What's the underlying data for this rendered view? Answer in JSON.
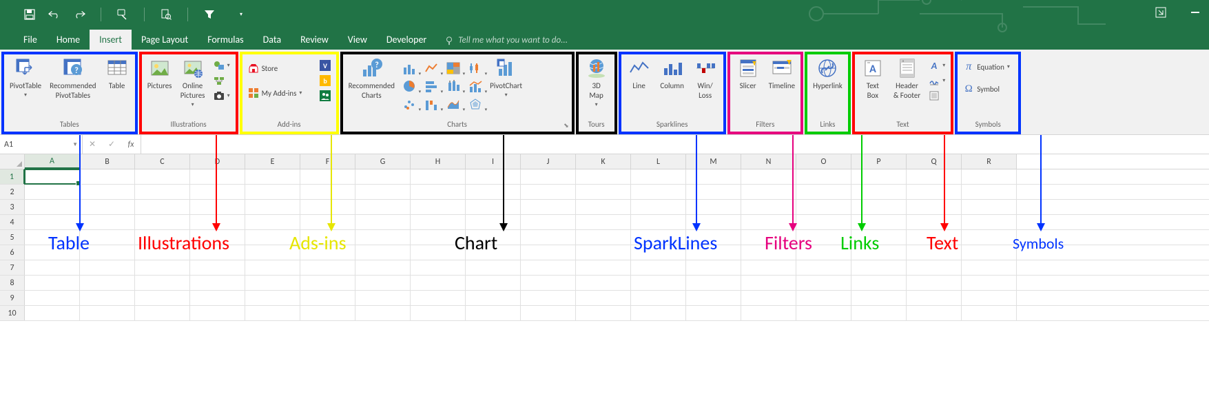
{
  "tabs": [
    "File",
    "Home",
    "Insert",
    "Page Layout",
    "Formulas",
    "Data",
    "Review",
    "View",
    "Developer"
  ],
  "active_tab": "Insert",
  "tellme_placeholder": "Tell me what you want to do...",
  "namebox": "A1",
  "columns": [
    "A",
    "B",
    "C",
    "D",
    "E",
    "F",
    "G",
    "H",
    "I",
    "J",
    "K",
    "L",
    "M",
    "N",
    "O",
    "P",
    "Q",
    "R"
  ],
  "rows": [
    "1",
    "2",
    "3",
    "4",
    "5",
    "6",
    "7",
    "8",
    "9",
    "10"
  ],
  "groups": {
    "tables": {
      "label": "Tables",
      "pivot": "PivotTable",
      "recpivot_l1": "Recommended",
      "recpivot_l2": "PivotTables",
      "table": "Table"
    },
    "illus": {
      "label": "Illustrations",
      "pictures": "Pictures",
      "online_l1": "Online",
      "online_l2": "Pictures"
    },
    "addins": {
      "label": "Add-ins",
      "store": "Store",
      "myaddins": "My Add-ins"
    },
    "charts": {
      "label": "Charts",
      "rec_l1": "Recommended",
      "rec_l2": "Charts",
      "pivotchart": "PivotChart"
    },
    "tours": {
      "label": "Tours",
      "map_l1": "3D",
      "map_l2": "Map"
    },
    "spark": {
      "label": "Sparklines",
      "line": "Line",
      "column": "Column",
      "winloss_l1": "Win/",
      "winloss_l2": "Loss"
    },
    "filters": {
      "label": "Filters",
      "slicer": "Slicer",
      "timeline": "Timeline"
    },
    "links": {
      "label": "Links",
      "hyper": "Hyperlink"
    },
    "text": {
      "label": "Text",
      "textbox_l1": "Text",
      "textbox_l2": "Box",
      "hf_l1": "Header",
      "hf_l2": "& Footer"
    },
    "symbols": {
      "label": "Symbols",
      "eq": "Equation",
      "sym": "Symbol"
    }
  },
  "annotations": {
    "table": "Table",
    "illustrations": "Illustrations",
    "addins": "Ads-ins",
    "chart": "Chart",
    "sparklines": "SparkLines",
    "filters": "Filters",
    "links": "Links",
    "text": "Text",
    "symbols": "Symbols"
  }
}
